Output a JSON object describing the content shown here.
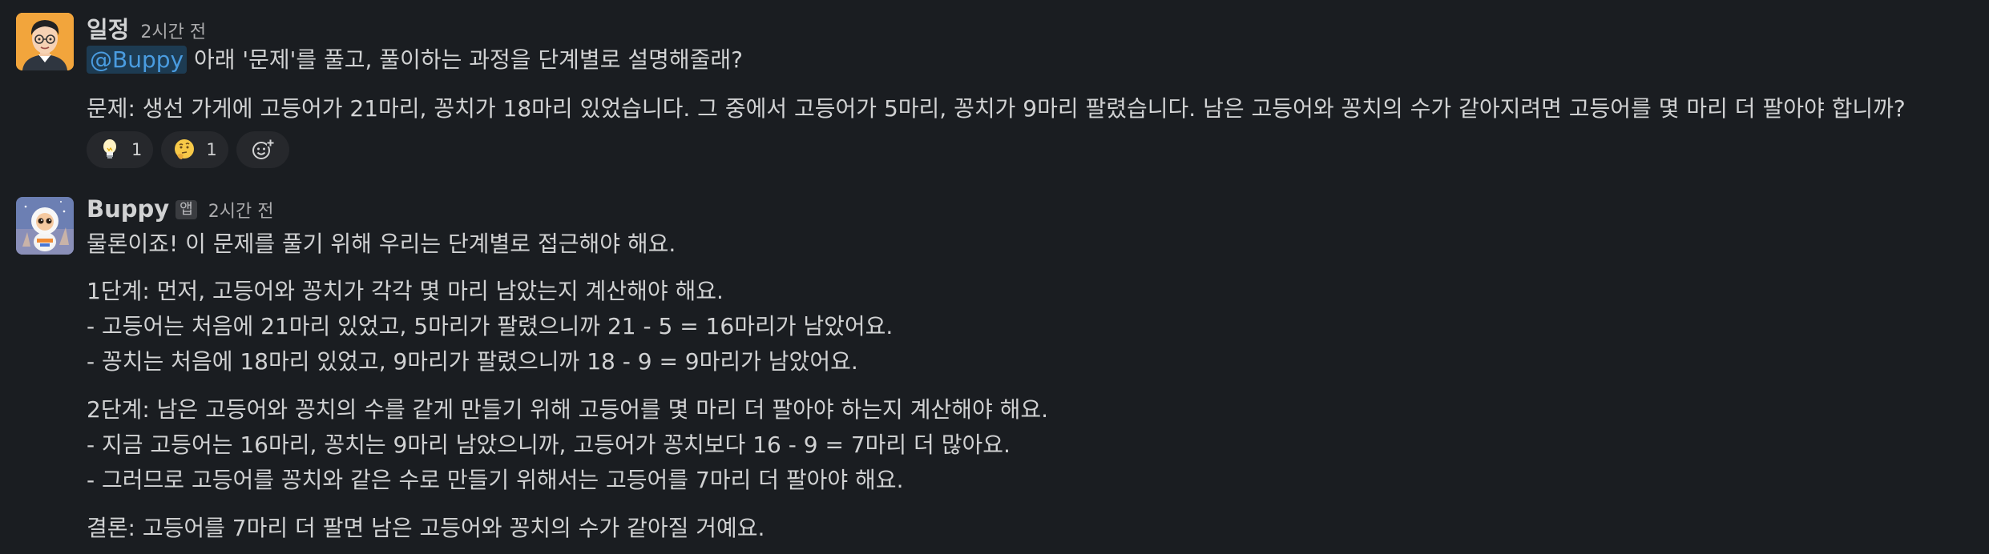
{
  "message1": {
    "author": "일정",
    "time": "2시간 전",
    "mention": "@Buppy",
    "request": " 아래 '문제'를 풀고, 풀이하는 과정을 단계별로 설명해줄래?",
    "problem": "문제: 생선 가게에 고등어가 21마리, 꽁치가 18마리 있었습니다. 그 중에서 고등어가 5마리, 꽁치가 9마리 팔렸습니다. 남은 고등어와 꽁치의 수가 같아지려면 고등어를 몇 마리 더 팔아야 합니까?",
    "reactions": [
      {
        "icon": "lightbulb-emoji",
        "count": "1"
      },
      {
        "icon": "thinking-face-emoji",
        "count": "1"
      }
    ],
    "add_reaction_icon": "add-reaction-icon"
  },
  "message2": {
    "author": "Buppy",
    "app_badge": "앱",
    "time": "2시간 전",
    "lines": [
      "물론이죠! 이 문제를 풀기 위해 우리는 단계별로 접근해야 해요.",
      "1단계: 먼저, 고등어와 꽁치가 각각 몇 마리 남았는지 계산해야 해요.",
      "- 고등어는 처음에 21마리 있었고, 5마리가 팔렸으니까 21 - 5 = 16마리가 남았어요.",
      "- 꽁치는 처음에 18마리 있었고, 9마리가 팔렸으니까 18 - 9 = 9마리가 남았어요.",
      "2단계: 남은 고등어와 꽁치의 수를 같게 만들기 위해 고등어를 몇 마리 더 팔아야 하는지 계산해야 해요.",
      "- 지금 고등어는 16마리, 꽁치는 9마리 남았으니까, 고등어가 꽁치보다 16 - 9 = 7마리 더 많아요.",
      "- 그러므로 고등어를 꽁치와 같은 수로 만들기 위해서는 고등어를 7마리 더 팔아야 해요.",
      "결론: 고등어를 7마리 더 팔면 남은 고등어와 꽁치의 수가 같아질 거예요."
    ]
  },
  "colors": {
    "background": "#1a1d21",
    "text": "#d1d2d3",
    "muted": "#ababad",
    "mention_bg": "#1d3b52",
    "mention_text": "#4a9ce0",
    "reaction_bg": "#26282c"
  }
}
